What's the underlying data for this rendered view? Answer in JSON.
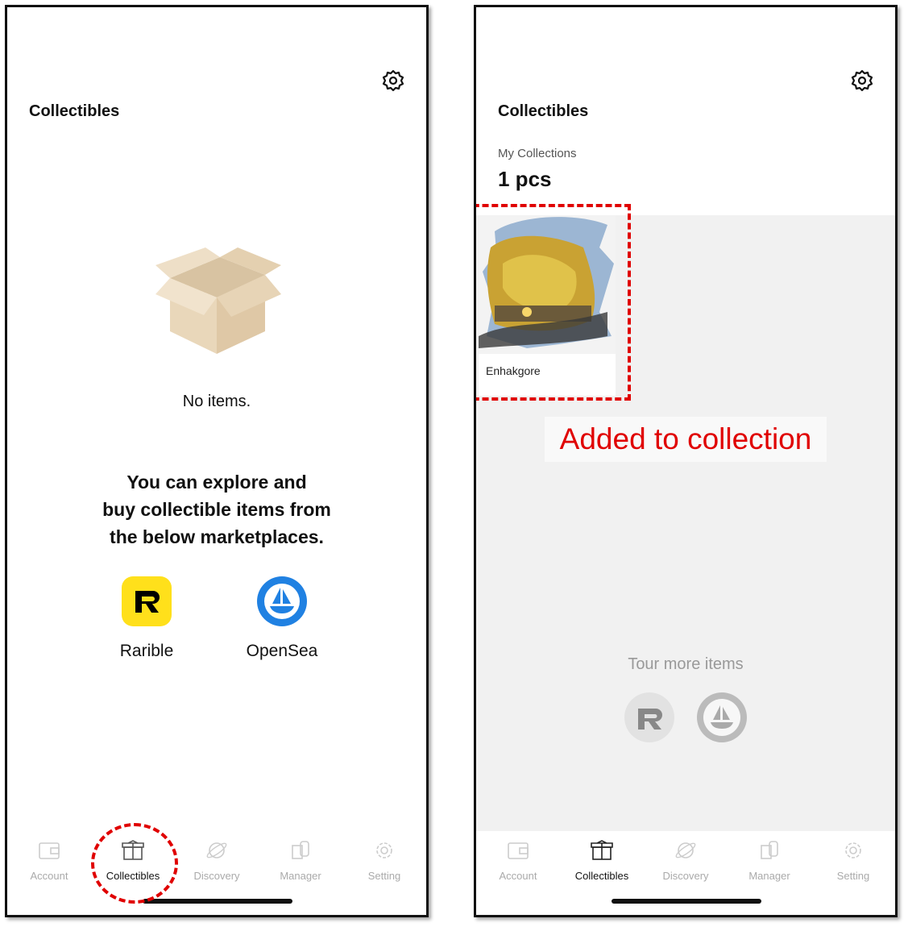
{
  "left": {
    "title": "Collectibles",
    "empty_text": "No items.",
    "explore_lines": [
      "You can explore and",
      "buy collectible items from",
      "the below marketplaces."
    ],
    "marketplaces": [
      {
        "label": "Rarible",
        "icon": "rarible-icon",
        "color": "#ffe01b"
      },
      {
        "label": "OpenSea",
        "icon": "opensea-icon",
        "color": "#2081e2"
      }
    ],
    "tabs": [
      {
        "label": "Account",
        "icon": "wallet-icon"
      },
      {
        "label": "Collectibles",
        "icon": "gift-box-icon",
        "active": true
      },
      {
        "label": "Discovery",
        "icon": "planet-icon"
      },
      {
        "label": "Manager",
        "icon": "manager-icon"
      },
      {
        "label": "Setting",
        "icon": "gear-icon"
      }
    ]
  },
  "right": {
    "title": "Collectibles",
    "section_label": "My Collections",
    "count": "1 pcs",
    "item_name": "Enhakgore",
    "callout": "Added to collection",
    "tour_label": "Tour more items",
    "tabs": [
      {
        "label": "Account",
        "icon": "wallet-icon"
      },
      {
        "label": "Collectibles",
        "icon": "gift-box-icon",
        "active": true
      },
      {
        "label": "Discovery",
        "icon": "planet-icon"
      },
      {
        "label": "Manager",
        "icon": "manager-icon"
      },
      {
        "label": "Setting",
        "icon": "gear-icon"
      }
    ]
  },
  "colors": {
    "callout_red": "#e00000",
    "box_tan": "#e8d2b0"
  }
}
